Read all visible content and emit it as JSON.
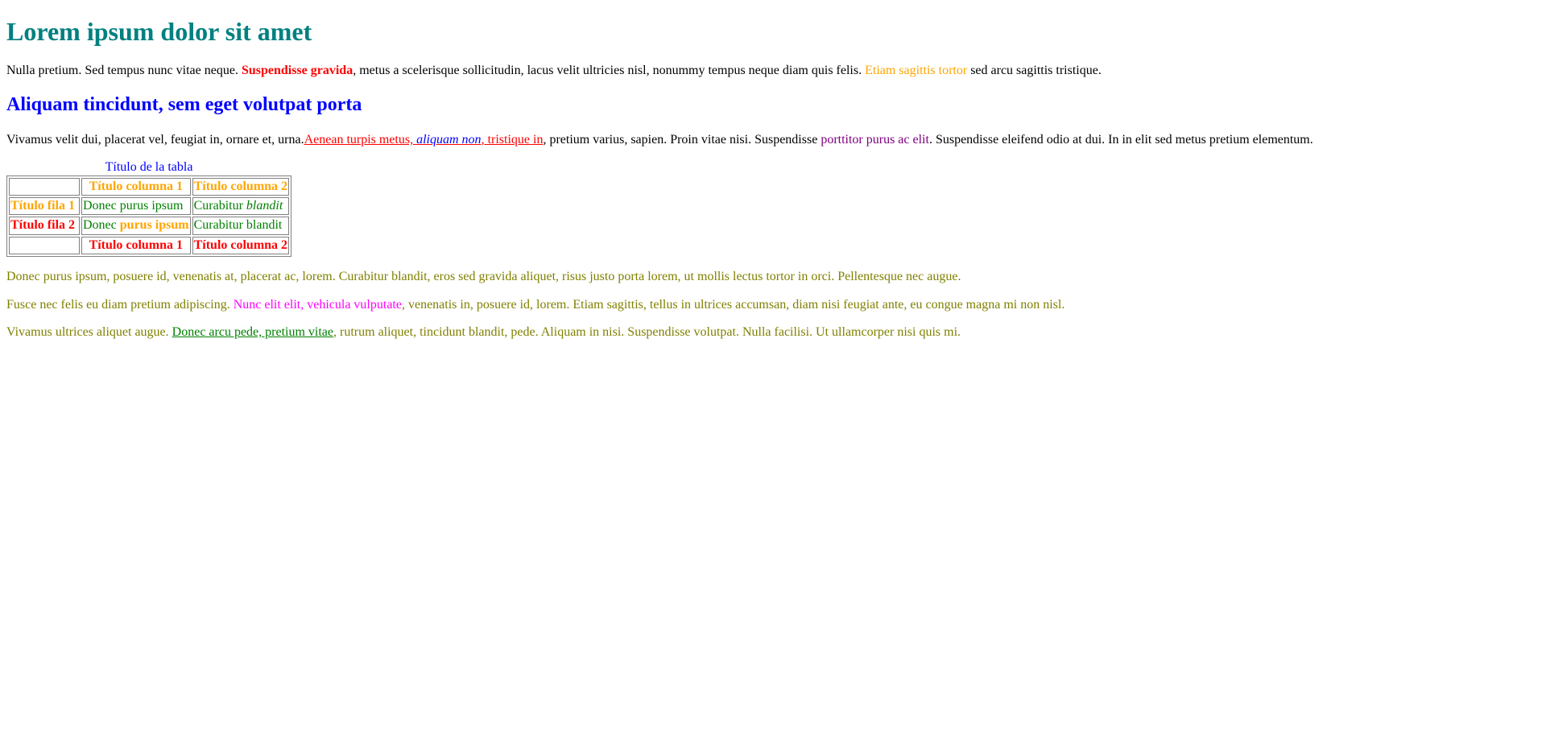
{
  "heading1": "Lorem ipsum dolor sit amet",
  "p1": {
    "t1": "Nulla pretium. Sed tempus nunc vitae neque. ",
    "bold_red": "Suspendisse gravida",
    "t2": ", metus a scelerisque sollicitudin, lacus velit ultricies nisl, nonummy tempus neque diam quis felis. ",
    "orange": "Etiam sagittis tortor",
    "t3": " sed arcu sagittis tristique."
  },
  "heading2": "Aliquam tincidunt, sem eget volutpat porta",
  "p2": {
    "t1": "Vivamus velit dui, placerat vel, feugiat in, ornare et, urna.",
    "link_a": "Aenean turpis metus, ",
    "link_b_em": "aliquam non",
    "link_c": ", tristique in",
    "t2": ", pretium varius, sapien. Proin vitae nisi. Suspendisse ",
    "purple": "porttitor purus ac elit",
    "t3": ". Suspendisse eleifend odio at dui. In in elit sed metus pretium elementum."
  },
  "table": {
    "caption": "Título de la tabla",
    "header": [
      "",
      "Título columna 1",
      "Título columna 2"
    ],
    "rows": [
      {
        "row_header": "Título fila 1",
        "c1": "Donec purus ipsum",
        "c2_plain": "Curabitur ",
        "c2_em": "blandit"
      },
      {
        "row_header": "Título fila 2",
        "c1_plain": "Donec ",
        "c1_bold": "purus ipsum",
        "c2": "Curabitur blandit"
      }
    ],
    "footer": [
      "",
      "Título columna 1",
      "Título columna 2"
    ]
  },
  "p3": "Donec purus ipsum, posuere id, venenatis at, placerat ac, lorem. Curabitur blandit, eros sed gravida aliquet, risus justo porta lorem, ut mollis lectus tortor in orci. Pellentesque nec augue.",
  "p4": {
    "t1": "Fusce nec felis eu diam pretium adipiscing. ",
    "magenta": "Nunc elit elit, vehicula vulputate",
    "t2": ", venenatis in, posuere id, lorem. Etiam sagittis, tellus in ultrices accumsan, diam nisi feugiat ante, eu congue magna mi non nisl."
  },
  "p5": {
    "t1": "Vivamus ultrices aliquet augue. ",
    "link": "Donec arcu pede, pretium vitae",
    "t2": ", rutrum aliquet, tincidunt blandit, pede. Aliquam in nisi. Suspendisse volutpat. Nulla facilisi. Ut ullamcorper nisi quis mi."
  },
  "colors": {
    "teal": "#008080",
    "blue": "#0000ff",
    "red": "#ff0000",
    "orange": "#ffa500",
    "purple": "#800080",
    "magenta": "#ff00ff",
    "green": "#008000",
    "olive": "#808000"
  }
}
